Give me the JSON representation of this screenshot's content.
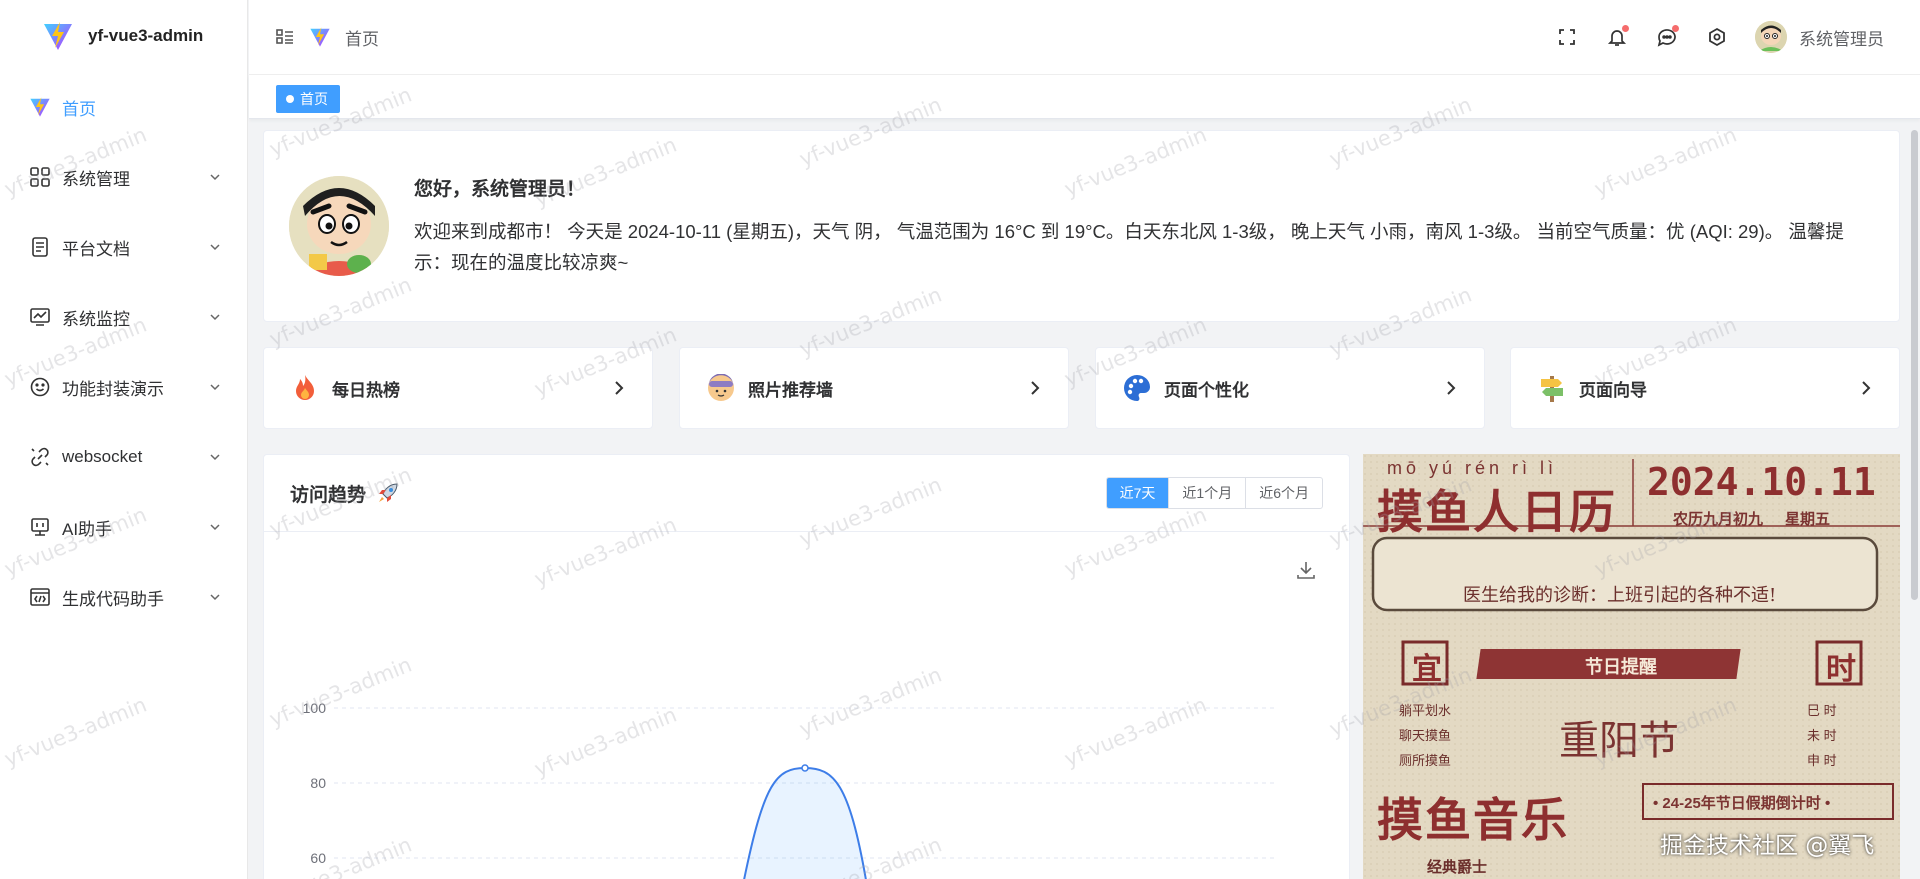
{
  "app": {
    "title": "yf-vue3-admin"
  },
  "sidebar": {
    "items": [
      {
        "label": "首页",
        "icon": "vite-logo-icon",
        "active": true
      },
      {
        "label": "系统管理",
        "icon": "grid-icon"
      },
      {
        "label": "平台文档",
        "icon": "document-icon"
      },
      {
        "label": "系统监控",
        "icon": "monitor-icon"
      },
      {
        "label": "功能封装演示",
        "icon": "smile-icon"
      },
      {
        "label": "websocket",
        "icon": "link-icon"
      },
      {
        "label": "AI助手",
        "icon": "screen-icon"
      },
      {
        "label": "生成代码助手",
        "icon": "code-icon"
      }
    ]
  },
  "header": {
    "breadcrumb": "首页",
    "username": "系统管理员"
  },
  "tabs": [
    {
      "label": "首页"
    }
  ],
  "welcome": {
    "greeting": "您好，系统管理员！",
    "message": "欢迎来到成都市！  今天是 2024-10-11 (星期五)，天气 阴，  气温范围为 16°C 到 19°C。白天东北风 1-3级，  晚上天气 小雨，南风 1-3级。 当前空气质量：优 (AQI: 29)。 温馨提示：现在的温度比较凉爽~"
  },
  "quick_links": [
    {
      "label": "每日热榜",
      "icon": "fire-icon"
    },
    {
      "label": "照片推荐墙",
      "icon": "face-icon"
    },
    {
      "label": "页面个性化",
      "icon": "palette-icon"
    },
    {
      "label": "页面向导",
      "icon": "signpost-icon"
    }
  ],
  "trend": {
    "title": "访问趋势",
    "ranges": [
      "近7天",
      "近1个月",
      "近6个月"
    ],
    "active_range": "近7天"
  },
  "chart_data": {
    "type": "area",
    "title": "",
    "y_ticks": [
      60,
      80,
      100
    ],
    "peak": 84,
    "grid": true
  },
  "calendar": {
    "pinyin": "mō  yú  rén  rì  lì",
    "title": "摸鱼人日历",
    "date": "2024.10.11",
    "lunar": "农历九月初九",
    "weekday": "星期五",
    "diagnosis": "医生给我的诊断：上班引起的各种不适!",
    "yi": "宜",
    "shi": "时",
    "festival_label": "节日提醒",
    "yi_items": [
      "躺平划水",
      "聊天摸鱼",
      "厕所摸鱼"
    ],
    "shi_items": [
      "巳 时",
      "未 时",
      "申 时"
    ],
    "festival": "重阳节",
    "music": "摸鱼音乐",
    "countdown": "• 24-25年节日假期倒计时 •",
    "music_sub": "经典爵士"
  },
  "footer_watermark": "掘金技术社区 @翼飞",
  "watermark_text": "yf-vue3-admin"
}
